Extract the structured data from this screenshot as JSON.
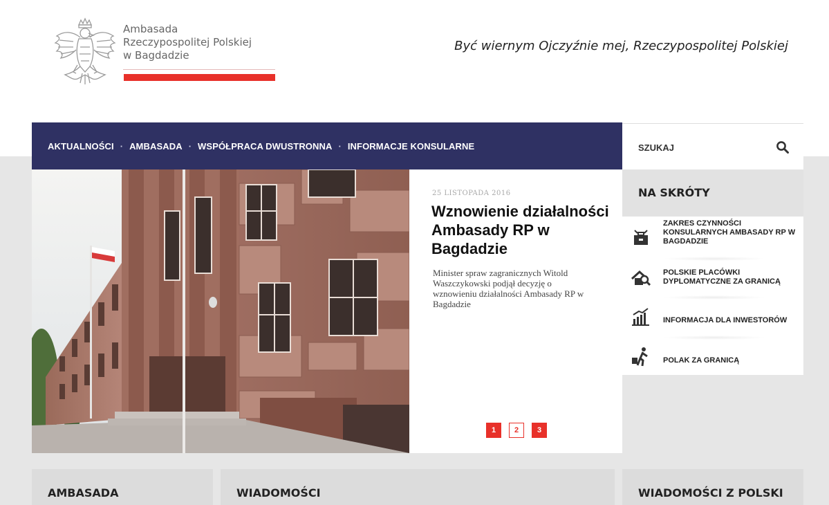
{
  "header": {
    "embassy_name_lines": [
      "Ambasada",
      "Rzeczypospolitej Polskiej",
      "w Bagdadzie"
    ],
    "motto": "Być wiernym Ojczyźnie mej, Rzeczypospolitej Polskiej",
    "logo_icon": "white-eagle-emblem-icon",
    "accent_color": "#e8312a"
  },
  "nav": {
    "items": [
      "AKTUALNOŚCI",
      "AMBASADA",
      "WSPÓŁPRACA DWUSTRONNA",
      "INFORMACJE KONSULARNE"
    ],
    "separator": "·",
    "background": "#2f3163"
  },
  "search": {
    "label": "SZUKAJ",
    "icon": "search-icon"
  },
  "slider": {
    "date": "25 LISTOPADA 2016",
    "title": "Wznowienie działalności Ambasady RP w Bagdadzie",
    "text": "Minister spraw zagranicznych Witold Waszczykowski podjął decyzję o wznowieniu działalności Ambasady RP w Bagdadzie",
    "pages": [
      "1",
      "2",
      "3"
    ],
    "active_page": "1"
  },
  "shortcuts": {
    "title": "NA SKRÓTY",
    "items": [
      {
        "label": "ZAKRES CZYNNOŚCI KONSULARNYCH AMBASADY RP W BAGDADZIE",
        "icon": "consular-briefcase-icon"
      },
      {
        "label": "POLSKIE PLACÓWKI DYPLOMATYCZNE ZA GRANICĄ",
        "icon": "house-search-icon"
      },
      {
        "label": "INFORMACJA DLA INWESTORÓW",
        "icon": "growth-chart-icon"
      },
      {
        "label": "POLAK ZA GRANICĄ",
        "icon": "traveler-luggage-icon"
      }
    ]
  },
  "bottom_sections": [
    "AMBASADA",
    "WIADOMOŚCI",
    "WIADOMOŚCI Z POLSKI"
  ]
}
